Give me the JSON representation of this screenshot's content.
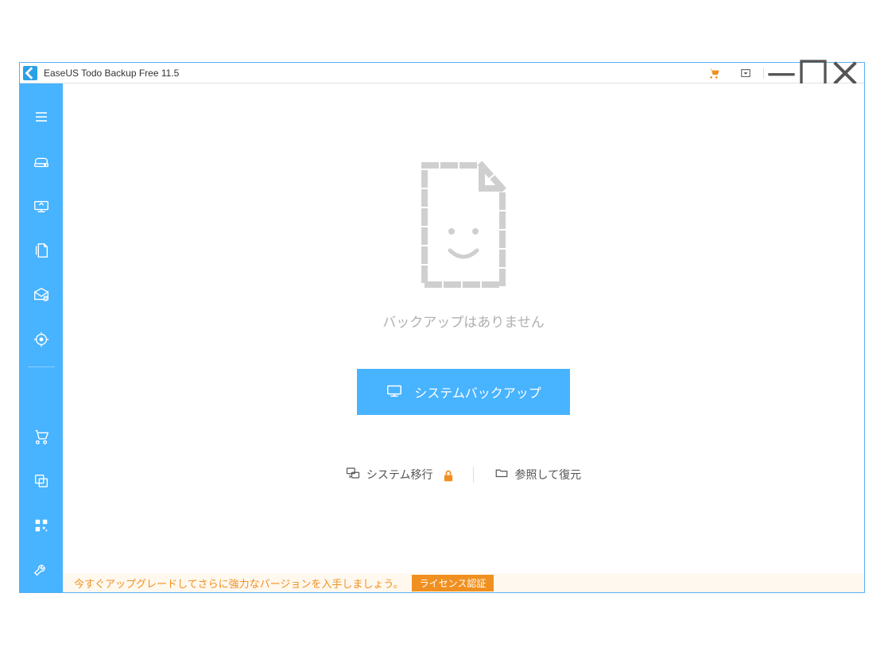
{
  "titlebar": {
    "app_icon_text": "«",
    "title": "EaseUS Todo Backup Free 11.5"
  },
  "main": {
    "empty_message": "バックアップはありません",
    "primary_button_label": "システムバックアップ",
    "secondary_actions": {
      "system_transfer": "システム移行",
      "browse_restore": "参照して復元"
    }
  },
  "upgrade": {
    "message": "今すぐアップグレードしてさらに強力なバージョンを入手しましょう。",
    "badge_label": "ライセンス認証"
  },
  "colors": {
    "primary": "#48b3ff",
    "accent": "#f09020"
  }
}
